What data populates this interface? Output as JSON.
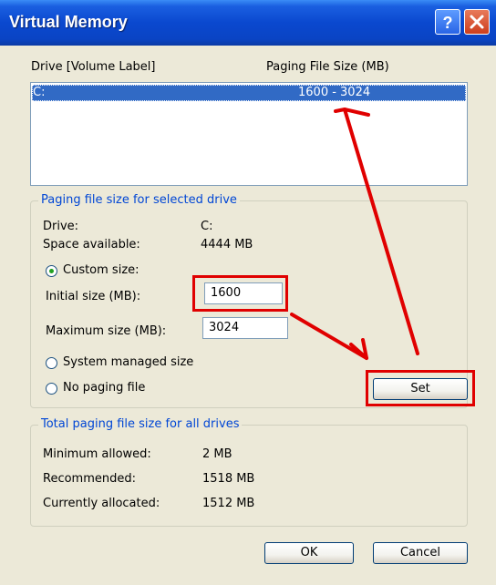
{
  "window": {
    "title": "Virtual Memory"
  },
  "drives": {
    "col_drive": "Drive  [Volume Label]",
    "col_size": "Paging File Size (MB)",
    "rows": [
      {
        "drive": "C:",
        "size": "1600 - 3024"
      }
    ]
  },
  "selected": {
    "legend": "Paging file size for selected drive",
    "drive_label": "Drive:",
    "drive_value": "C:",
    "space_label": "Space available:",
    "space_value": "4444 MB",
    "custom_label": "Custom size:",
    "initial_label": "Initial size (MB):",
    "initial_value": "1600",
    "max_label": "Maximum size (MB):",
    "max_value": "3024",
    "system_label": "System managed size",
    "nopaging_label": "No paging file",
    "set_label": "Set",
    "selected_option": "custom"
  },
  "total": {
    "legend": "Total paging file size for all drives",
    "min_label": "Minimum allowed:",
    "min_value": "2 MB",
    "rec_label": "Recommended:",
    "rec_value": "1518 MB",
    "cur_label": "Currently allocated:",
    "cur_value": "1512 MB"
  },
  "buttons": {
    "ok": "OK",
    "cancel": "Cancel"
  },
  "colors": {
    "annotation": "#e00000",
    "title_bar": "#0a48cf",
    "selection": "#316ac5"
  }
}
